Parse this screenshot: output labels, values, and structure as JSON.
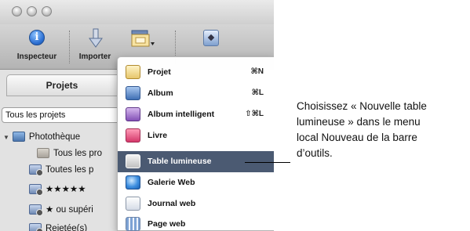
{
  "toolbar": {
    "inspector_label": "Inspecteur",
    "import_label": "Importer",
    "inspector_icon_glyph": "i"
  },
  "panel": {
    "title": "Projets",
    "select_value": "Tous les projets",
    "tree": [
      {
        "label": "Photothèque",
        "icon": "library-icon"
      },
      {
        "label": "Tous les pro",
        "icon": "folder-icon"
      },
      {
        "label": "Toutes les p",
        "icon": "smart-album-icon"
      },
      {
        "label": "★★★★★",
        "icon": "smart-album-icon"
      },
      {
        "label": "★ ou supéri",
        "icon": "smart-album-icon"
      },
      {
        "label": "Rejetée(s)",
        "icon": "smart-album-icon"
      }
    ]
  },
  "menu": {
    "items": [
      {
        "label": "Projet",
        "shortcut": "⌘N",
        "icon": "project-icon"
      },
      {
        "label": "Album",
        "shortcut": "⌘L",
        "icon": "album-icon"
      },
      {
        "label": "Album intelligent",
        "shortcut": "⇧⌘L",
        "icon": "smart-album-icon"
      },
      {
        "label": "Livre",
        "shortcut": "",
        "icon": "book-icon"
      },
      {
        "label": "Table lumineuse",
        "shortcut": "",
        "icon": "light-table-icon",
        "selected": true
      },
      {
        "label": "Galerie Web",
        "shortcut": "",
        "icon": "web-gallery-icon"
      },
      {
        "label": "Journal web",
        "shortcut": "",
        "icon": "web-journal-icon"
      },
      {
        "label": "Page web",
        "shortcut": "",
        "icon": "web-page-icon"
      }
    ]
  },
  "callout": {
    "lines": [
      "Choisissez « Nouvelle table",
      "lumineuse » dans le menu",
      "local Nouveau de la barre",
      "d’outils."
    ]
  },
  "colors": {
    "menu_highlight": "#4b5a72",
    "inspector_blue": "#2c6fd2"
  }
}
